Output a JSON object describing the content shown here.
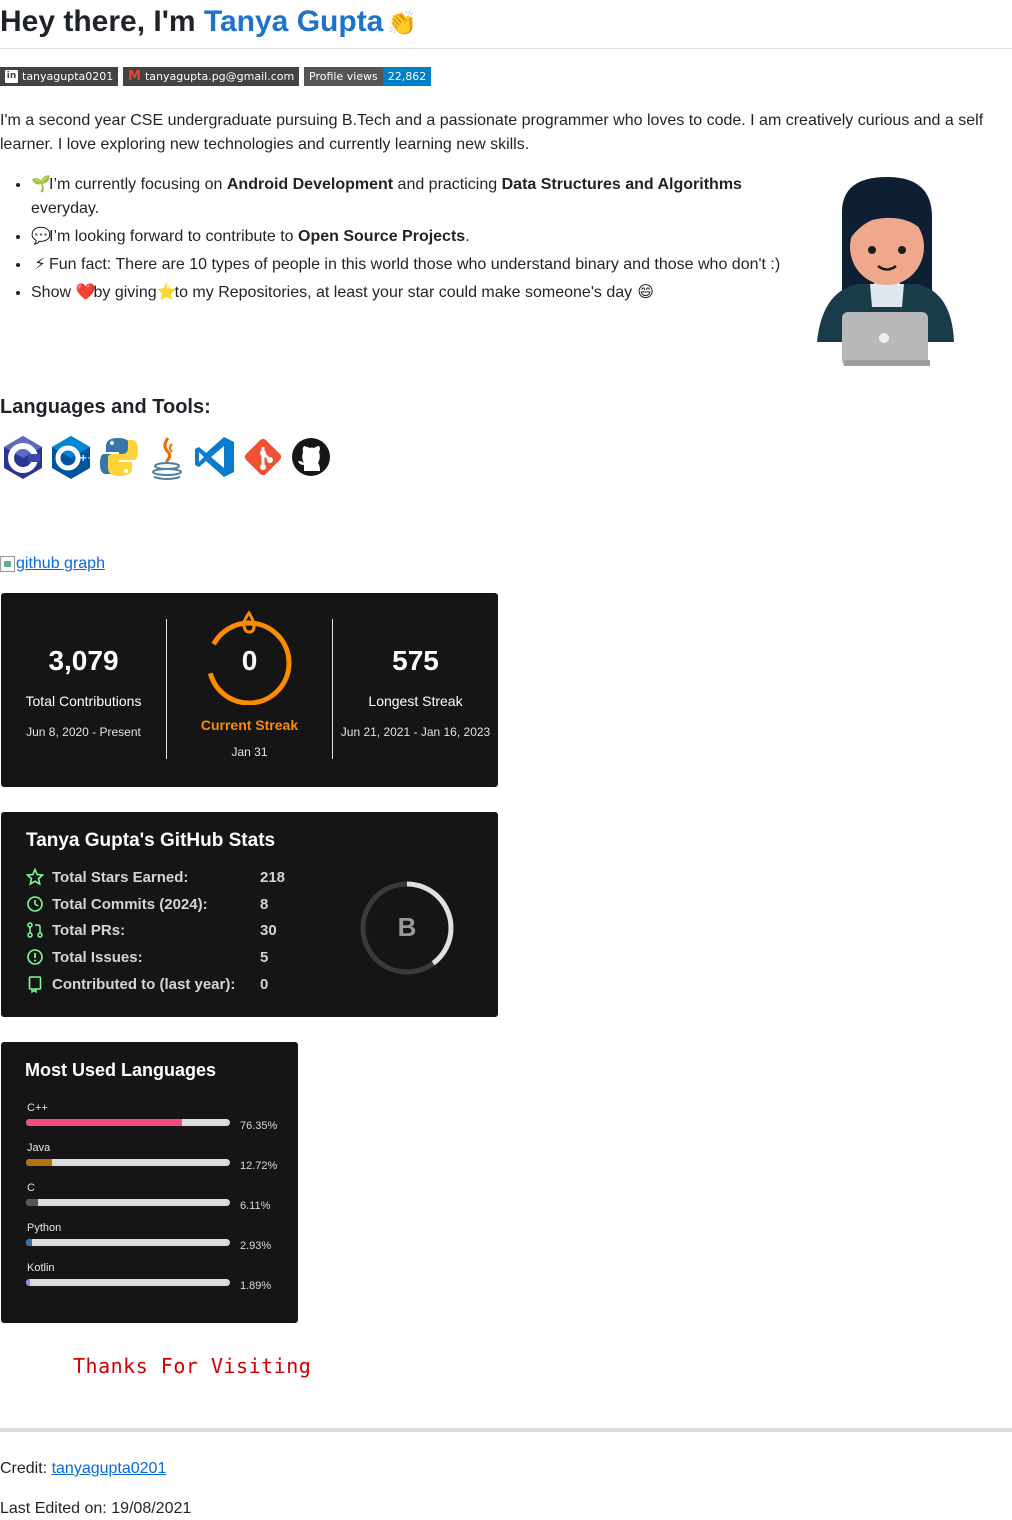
{
  "header": {
    "greeting": "Hey there, I'm ",
    "name": "Tanya Gupta",
    "wave_emoji": "👏"
  },
  "badges": {
    "linkedin": "tanyagupta0201",
    "gmail": "tanyagupta.pg@gmail.com",
    "views_label": "Profile views",
    "views_count": "22,862"
  },
  "intro": "I'm a second year CSE undergraduate pursuing B.Tech and a passionate programmer who loves to code. I am creatively curious and a self learner. I love exploring new technologies and currently learning new skills.",
  "bullets": [
    {
      "e": "🌱",
      "a": "I’m currently focusing on ",
      "b1": "Android Development",
      "c": " and practicing ",
      "b2": "Data Structures and Algorithms",
      "d": " everyday."
    },
    {
      "e": "💬",
      "a": "I’m looking forward to contribute to ",
      "b1": "Open Source Projects",
      "c": "."
    },
    {
      "e": "⚡",
      "a": "Fun fact: There are 10 types of people in this world those who understand binary and those who don't :)"
    },
    {
      "a": "Show ",
      "e1": "❤️",
      "b": "by giving",
      "e2": "⭐",
      "c": "to my Repositories, at least your star could make someone's day ",
      "e3": "😄"
    }
  ],
  "languages_title": "Languages and Tools:",
  "tools": [
    "c-icon",
    "cplusplus-icon",
    "python-icon",
    "java-icon",
    "vscode-icon",
    "git-icon",
    "github-icon"
  ],
  "github_graph_alt": "github graph",
  "streak": {
    "total": "3,079",
    "total_label": "Total Contributions",
    "total_range": "Jun 8, 2020 - Present",
    "current": "0",
    "current_label": "Current Streak",
    "current_date": "Jan 31",
    "longest": "575",
    "longest_label": "Longest Streak",
    "longest_range": "Jun 21, 2021 - Jan 16, 2023",
    "accent": "#fb8c00"
  },
  "stats": {
    "title": "Tanya Gupta's GitHub Stats",
    "rows": [
      {
        "label": "Total Stars Earned:",
        "value": "218",
        "icon": "star-icon"
      },
      {
        "label": "Total Commits (2024):",
        "value": "8",
        "icon": "history-icon"
      },
      {
        "label": "Total PRs:",
        "value": "30",
        "icon": "pull-request-icon"
      },
      {
        "label": "Total Issues:",
        "value": "5",
        "icon": "issue-icon"
      },
      {
        "label": "Contributed to (last year):",
        "value": "0",
        "icon": "repo-icon"
      }
    ],
    "rank": "B",
    "icon_color": "#79ff97"
  },
  "most_used": {
    "title": "Most Used Languages",
    "items": [
      {
        "name": "C++",
        "pct": "76.35%",
        "value": 76.35,
        "color": "#f34b7d"
      },
      {
        "name": "Java",
        "pct": "12.72%",
        "value": 12.72,
        "color": "#b07219"
      },
      {
        "name": "C",
        "pct": "6.11%",
        "value": 6.11,
        "color": "#555555"
      },
      {
        "name": "Python",
        "pct": "2.93%",
        "value": 2.93,
        "color": "#3572A5"
      },
      {
        "name": "Kotlin",
        "pct": "1.89%",
        "value": 1.89,
        "color": "#A97BFF"
      }
    ]
  },
  "thanks": "Thanks For Visiting",
  "footer": {
    "credit_label": "Credit: ",
    "credit_link": "tanyagupta0201",
    "edited": "Last Edited on: 19/08/2021"
  }
}
